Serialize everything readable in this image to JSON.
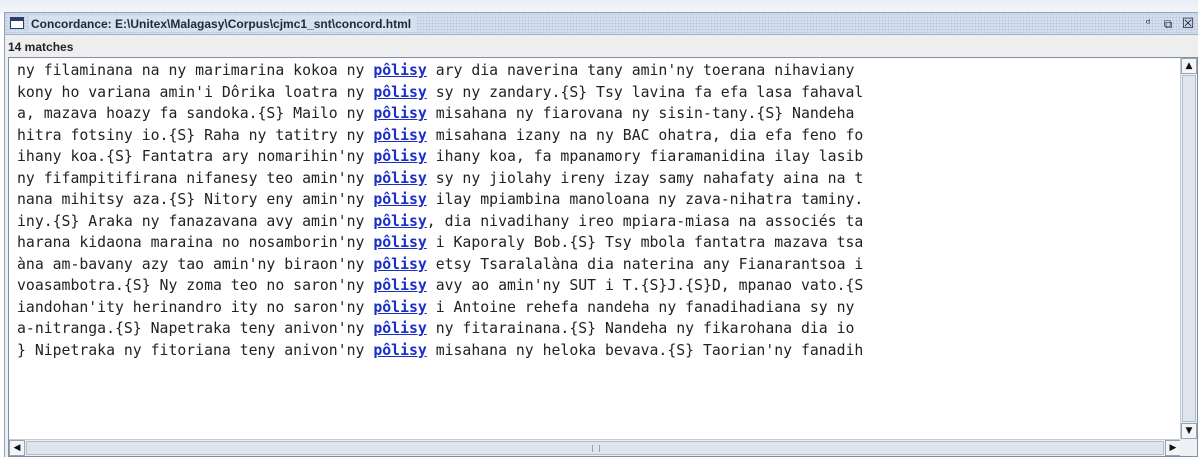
{
  "window": {
    "title": "Concordance: E:\\Unitex\\Malagasy\\Corpus\\cjmc1_snt\\concord.html",
    "controls": {
      "iconify": "ᵈ",
      "maximize": "⧉",
      "close": "☒"
    }
  },
  "match_count_label": "14 matches",
  "colors": {
    "match_link": "#1a2ec8",
    "titlebar": "#d6e0ee",
    "text": "#222222"
  },
  "concordance": {
    "lines": [
      {
        "left": "ny filaminana na ny marimarina kokoa ny ",
        "match": "pôlisy",
        "right": " ary dia naverina tany amin'ny toerana nihaviany"
      },
      {
        "left": "kony ho variana amin'i Dôrika loatra ny ",
        "match": "pôlisy",
        "right": " sy ny zandary.{S} Tsy lavina fa efa lasa fahaval"
      },
      {
        "left": "a, mazava hoazy fa sandoka.{S} Mailo ny ",
        "match": "pôlisy",
        "right": " misahana ny fiarovana ny sisin-tany.{S} Nandeha"
      },
      {
        "left": "hitra fotsiny io.{S} Raha ny tatitry ny ",
        "match": "pôlisy",
        "right": " misahana izany na ny BAC ohatra, dia efa feno fo"
      },
      {
        "left": "ihany koa.{S} Fantatra ary nomarihin'ny ",
        "match": "pôlisy",
        "right": " ihany koa, fa mpanamory fiaramanidina ilay lasib"
      },
      {
        "left": "ny fifampitifirana nifanesy teo amin'ny ",
        "match": "pôlisy",
        "right": " sy ny jiolahy ireny izay samy nahafaty aina na t"
      },
      {
        "left": "nana mihitsy aza.{S} Nitory eny amin'ny ",
        "match": "pôlisy",
        "right": " ilay mpiambina manoloana ny zava-nihatra taminy."
      },
      {
        "left": "iny.{S} Araka ny fanazavana avy amin'ny ",
        "match": "pôlisy",
        "right": ", dia nivadihany ireo mpiara-miasa na associés ta"
      },
      {
        "left": "harana kidaona maraina no nosamborin'ny ",
        "match": "pôlisy",
        "right": " i Kaporaly Bob.{S} Tsy mbola fantatra mazava tsa"
      },
      {
        "left": "àna am-bavany azy tao amin'ny biraon'ny ",
        "match": "pôlisy",
        "right": " etsy Tsaralalàna dia naterina any Fianarantsoa i"
      },
      {
        "left": "voasambotra.{S} Ny zoma teo no saron'ny ",
        "match": "pôlisy",
        "right": " avy ao amin'ny SUT i T.{S}J.{S}D, mpanao vato.{S"
      },
      {
        "left": "iandohan'ity herinandro ity no saron'ny ",
        "match": "pôlisy",
        "right": " i Antoine rehefa nandeha ny fanadihadiana sy ny"
      },
      {
        "left": "a-nitranga.{S} Napetraka teny anivon'ny ",
        "match": "pôlisy",
        "right": " ny fitarainana.{S} Nandeha ny fikarohana dia io"
      },
      {
        "left": "} Nipetraka ny fitoriana teny anivon'ny ",
        "match": "pôlisy",
        "right": " misahana ny heloka bevava.{S} Taorian'ny fanadih"
      }
    ]
  },
  "scrollbars": {
    "up_arrow": "▲",
    "down_arrow": "▼",
    "left_arrow": "◀",
    "right_arrow": "▶"
  }
}
